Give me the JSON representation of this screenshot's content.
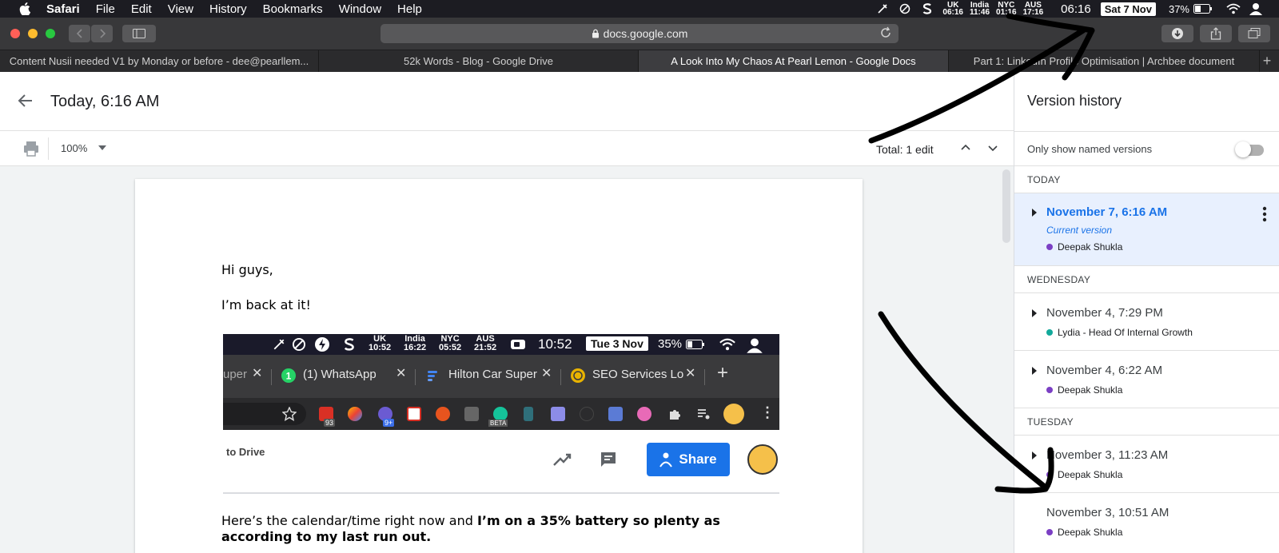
{
  "menubar": {
    "app_name": "Safari",
    "menus": [
      "File",
      "Edit",
      "View",
      "History",
      "Bookmarks",
      "Window",
      "Help"
    ],
    "clocks": [
      {
        "city": "UK",
        "time": "06:16"
      },
      {
        "city": "India",
        "time": "11:46"
      },
      {
        "city": "NYC",
        "time": "01:16"
      },
      {
        "city": "AUS",
        "time": "17:16"
      }
    ],
    "time": "06:16",
    "date": "Sat 7 Nov",
    "battery": "37%"
  },
  "browser": {
    "url": "docs.google.com",
    "tabs": [
      {
        "label": "Content Nusii needed V1 by Monday or before - dee@pearllem..."
      },
      {
        "label": "52k Words - Blog - Google Drive"
      },
      {
        "label": "A Look Into My Chaos At Pearl Lemon - Google Docs"
      },
      {
        "label": "Part 1: LinkedIn Profile Optimisation | Archbee document"
      }
    ],
    "new_tab": "+"
  },
  "doc": {
    "title": "Today, 6:16 AM",
    "zoom": "100%",
    "total_edits": "Total: 1 edit",
    "greeting": "Hi guys,",
    "line2": "I’m back at it!",
    "closing_plain": "Here’s the calendar/time right now and ",
    "closing_bold": "I’m on a 35% battery so plenty as according to my last run out."
  },
  "embedded": {
    "clocks": [
      {
        "city": "UK",
        "time": "10:52"
      },
      {
        "city": "India",
        "time": "16:22"
      },
      {
        "city": "NYC",
        "time": "05:52"
      },
      {
        "city": "AUS",
        "time": "21:52"
      }
    ],
    "time": "10:52",
    "date": "Tue 3 Nov",
    "battery": "35%",
    "tab_partial": "uper",
    "tab_whatsapp": "(1) WhatsApp",
    "tab_whatsapp_badge": "1",
    "tab_hilton": "Hilton Car Super",
    "tab_seo": "SEO Services Lo",
    "ext_badge_1": "93",
    "ext_badge_2": "9+",
    "ext_badge_beta": "BETA",
    "drive_text": "to Drive",
    "share_label": "Share"
  },
  "version_history": {
    "title": "Version history",
    "filter_label": "Only show named versions",
    "filter_on": false,
    "groups": [
      {
        "label": "TODAY"
      },
      {
        "label": "WEDNESDAY"
      },
      {
        "label": "TUESDAY"
      }
    ],
    "entries": [
      {
        "date": "November 7, 6:16 AM",
        "current": "Current version",
        "author": "Deepak Shukla",
        "dot_color": "#7b3fc4"
      },
      {
        "date": "November 4, 7:29 PM",
        "author": "Lydia - Head Of Internal Growth",
        "dot_color": "#12a99b"
      },
      {
        "date": "November 4, 6:22 AM",
        "author": "Deepak Shukla",
        "dot_color": "#7b3fc4"
      },
      {
        "date": "November 3, 11:23 AM",
        "author": "Deepak Shukla",
        "dot_color": "#7b3fc4"
      },
      {
        "date": "November 3, 10:51 AM",
        "author": "Deepak Shukla",
        "dot_color": "#7b3fc4"
      }
    ]
  },
  "colors": {
    "accent": "#1a73e8",
    "selected_bg": "#e8f0fe"
  }
}
